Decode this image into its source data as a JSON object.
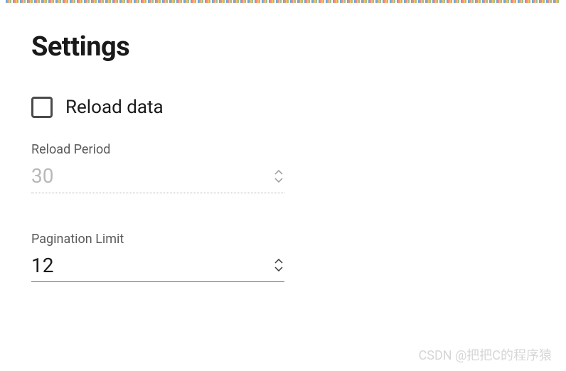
{
  "title": "Settings",
  "reload": {
    "checkbox_label": "Reload data",
    "checked": false,
    "period_label": "Reload Period",
    "period_value": "30"
  },
  "pagination": {
    "label": "Pagination Limit",
    "value": "12"
  },
  "watermark": "CSDN @把把C的程序猿"
}
